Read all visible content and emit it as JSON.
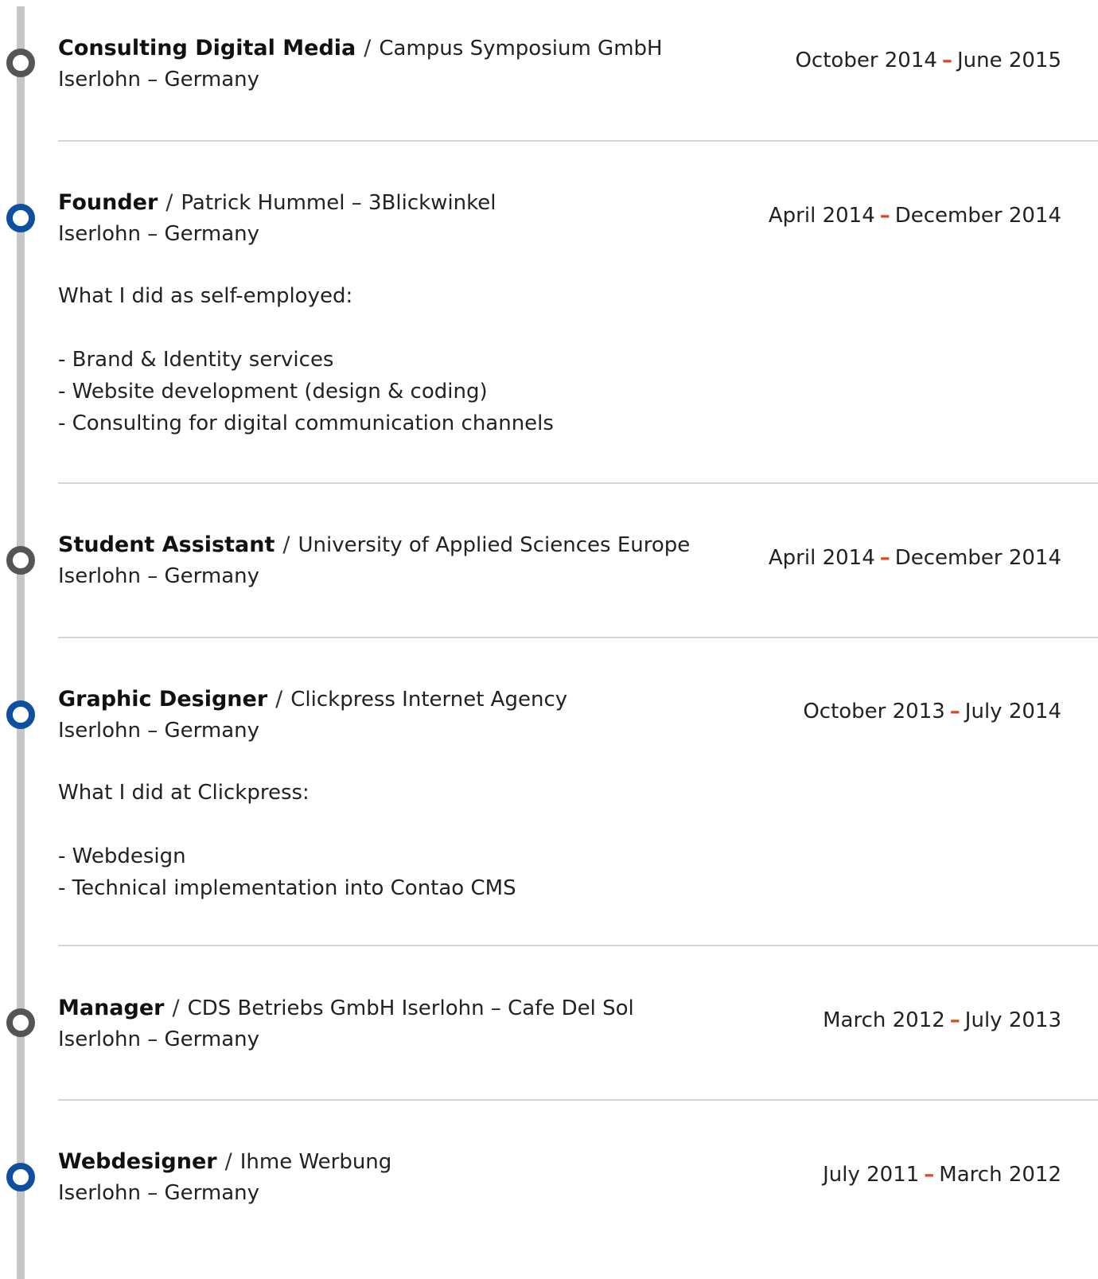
{
  "separator": "/",
  "date_dash": "–",
  "entries": [
    {
      "role": "Consulting Digital Media",
      "company": "Campus Symposium GmbH",
      "location": "Iserlohn – Germany",
      "start": "October 2014",
      "end": "June 2015",
      "dot_color": "gray",
      "description": []
    },
    {
      "role": "Founder",
      "company": "Patrick Hummel – 3Blickwinkel",
      "location": "Iserlohn – Germany",
      "start": "April 2014",
      "end": "December 2014",
      "dot_color": "blue",
      "description": [
        "What I did as self-employed:",
        "",
        "- Brand & Identity services",
        "- Website development (design & coding)",
        "- Consulting for digital communication channels"
      ]
    },
    {
      "role": "Student Assistant",
      "company": "University of Applied Sciences Europe",
      "location": "Iserlohn – Germany",
      "start": "April 2014",
      "end": "December 2014",
      "dot_color": "gray",
      "description": []
    },
    {
      "role": "Graphic Designer",
      "company": "Clickpress Internet Agency",
      "location": "Iserlohn – Germany",
      "start": "October 2013",
      "end": "July 2014",
      "dot_color": "blue",
      "description": [
        "What I did at Clickpress:",
        "",
        "- Webdesign",
        "- Technical implementation into Contao CMS"
      ]
    },
    {
      "role": "Manager",
      "company": "CDS Betriebs GmbH Iserlohn – Cafe Del Sol",
      "location": "Iserlohn – Germany",
      "start": "March 2012",
      "end": "July 2013",
      "dot_color": "gray",
      "description": []
    },
    {
      "role": "Webdesigner",
      "company": "Ihme Werbung",
      "location": "Iserlohn – Germany",
      "start": "July 2011",
      "end": "March 2012",
      "dot_color": "blue",
      "description": []
    }
  ],
  "colors": {
    "accent_blue": "#0f4fa0",
    "dot_gray": "#555555",
    "date_dash": "#e0461e",
    "timeline": "#c6c6c6",
    "divider": "#d6d6d6"
  }
}
